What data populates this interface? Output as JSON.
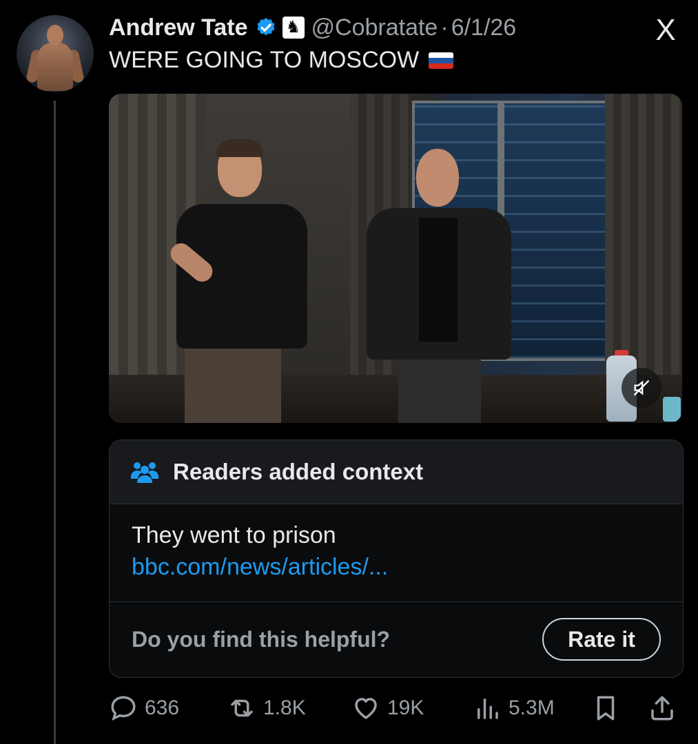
{
  "tweet": {
    "author_name": "Andrew Tate",
    "handle": "@Cobratate",
    "separator": "·",
    "date": "6/1/26",
    "text": "WERE GOING TO MOSCOW",
    "affiliation_badge_icon": "♞",
    "app_logo": "X",
    "verified_color": "#1d9bf0"
  },
  "media": {
    "mute_icon": "mute-icon"
  },
  "community_note": {
    "title": "Readers added context",
    "body": "They went to prison",
    "link": "bbc.com/news/articles/...",
    "prompt": "Do you find this helpful?",
    "rate_label": "Rate it"
  },
  "actions": {
    "replies": "636",
    "reposts": "1.8K",
    "likes": "19K",
    "views": "5.3M"
  },
  "colors": {
    "background": "#000000",
    "link": "#1d9bf0",
    "muted_text": "#9aa0a6"
  }
}
